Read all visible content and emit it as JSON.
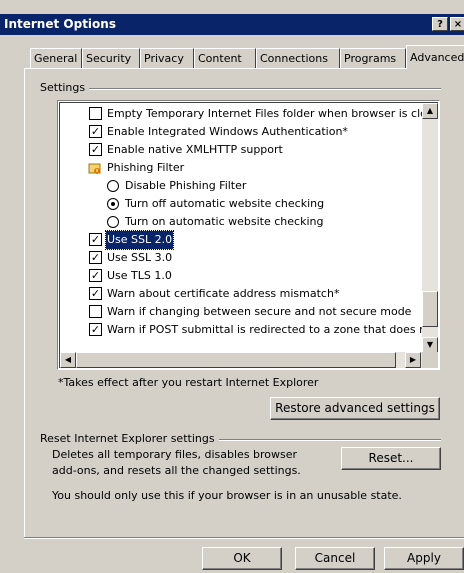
{
  "window": {
    "title": "Internet Options",
    "help_label": "?",
    "close_label": "×"
  },
  "tabs": [
    "General",
    "Security",
    "Privacy",
    "Content",
    "Connections",
    "Programs",
    "Advanced"
  ],
  "settings_group_label": "Settings",
  "settings_items": [
    {
      "type": "checkbox",
      "checked": false,
      "label": "Empty Temporary Internet Files folder when browser is clc"
    },
    {
      "type": "checkbox",
      "checked": true,
      "label": "Enable Integrated Windows Authentication*"
    },
    {
      "type": "checkbox",
      "checked": true,
      "label": "Enable native XMLHTTP support"
    },
    {
      "type": "category",
      "icon": "lock-icon",
      "label": "Phishing Filter"
    },
    {
      "type": "radio",
      "checked": false,
      "label": "Disable Phishing Filter"
    },
    {
      "type": "radio",
      "checked": true,
      "label": "Turn off automatic website checking"
    },
    {
      "type": "radio",
      "checked": false,
      "label": "Turn on automatic website checking"
    },
    {
      "type": "checkbox",
      "checked": true,
      "label": "Use SSL 2.0",
      "selected": true
    },
    {
      "type": "checkbox",
      "checked": true,
      "label": "Use SSL 3.0"
    },
    {
      "type": "checkbox",
      "checked": true,
      "label": "Use TLS 1.0"
    },
    {
      "type": "checkbox",
      "checked": true,
      "label": "Warn about certificate address mismatch*"
    },
    {
      "type": "checkbox",
      "checked": false,
      "label": "Warn if changing between secure and not secure mode"
    },
    {
      "type": "checkbox",
      "checked": true,
      "label": "Warn if POST submittal is redirected to a zone that does n"
    }
  ],
  "restart_note": "*Takes effect after you restart Internet Explorer",
  "restore_button": "Restore advanced settings",
  "reset_group_label": "Reset Internet Explorer settings",
  "reset_description_line1": "Deletes all temporary files, disables browser",
  "reset_description_line2": "add-ons, and resets all the changed settings.",
  "reset_button": "Reset...",
  "reset_warning": "You should only use this if your browser is in an unusable state.",
  "footer": {
    "ok": "OK",
    "cancel": "Cancel",
    "apply": "Apply"
  }
}
